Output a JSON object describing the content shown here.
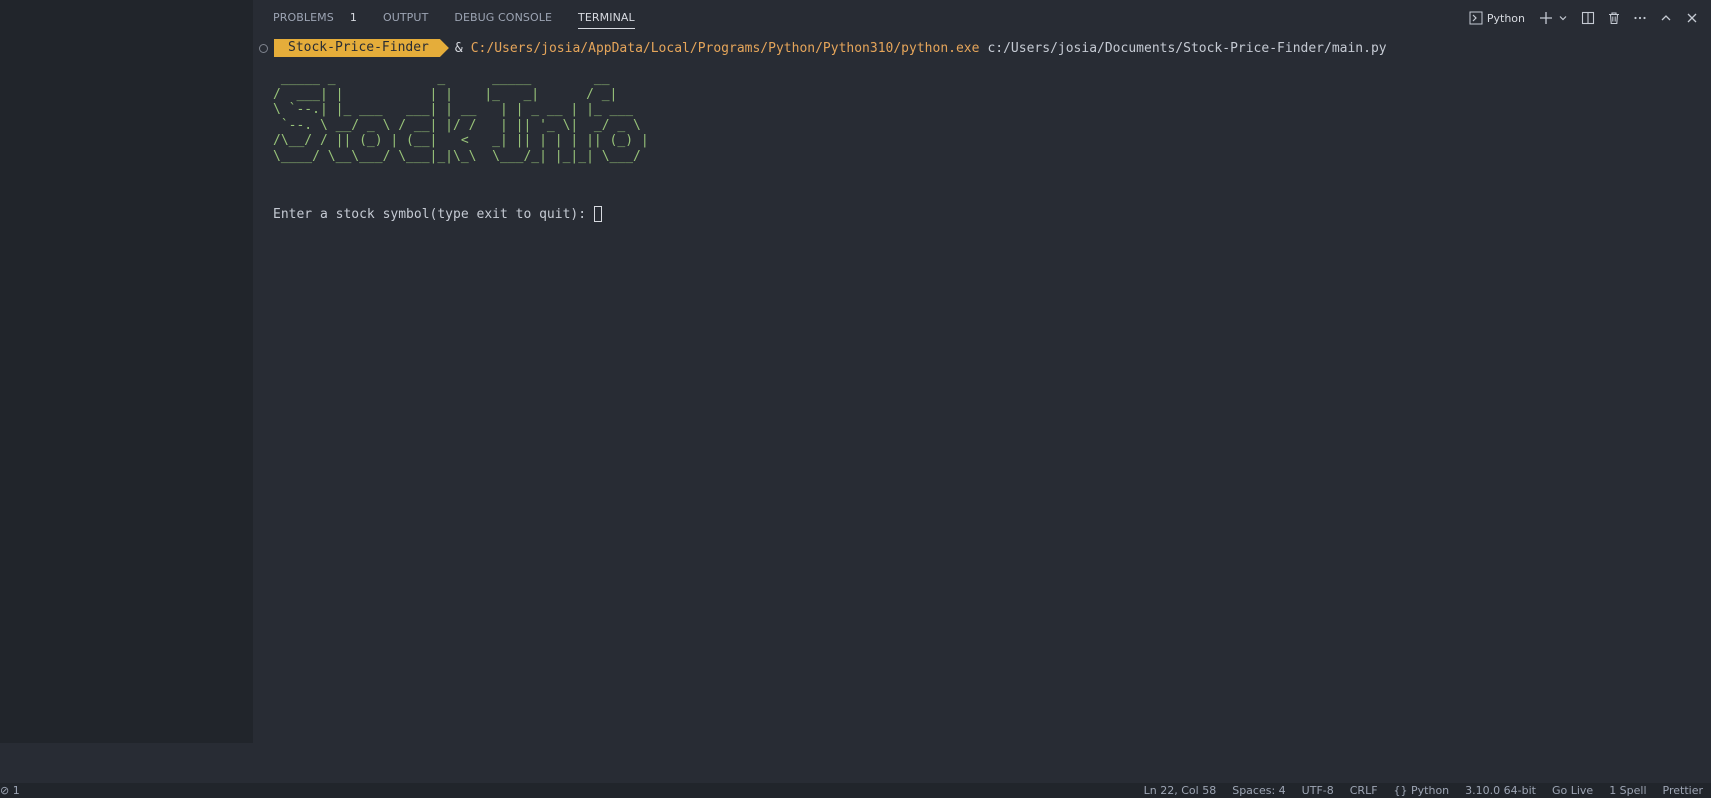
{
  "panel": {
    "tabs": [
      {
        "label": "PROBLEMS",
        "badge": "1"
      },
      {
        "label": "OUTPUT"
      },
      {
        "label": "DEBUG CONSOLE"
      },
      {
        "label": "TERMINAL",
        "active": true
      }
    ],
    "toolbar": {
      "terminal_name": "Python",
      "icons": [
        "terminal-icon",
        "add-icon",
        "chevron-down-icon",
        "split-icon",
        "trash-icon",
        "more-icon",
        "chevron-up-icon",
        "close-icon"
      ]
    }
  },
  "terminal": {
    "prompt_label": "Stock-Price-Finder",
    "amp": "&",
    "command_exe": "C:/Users/josia/AppData/Local/Programs/Python/Python310/python.exe",
    "command_arg": "c:/Users/josia/Documents/Stock-Price-Finder/main.py",
    "ascii_art": " _____ _             _      _____        __      \n/  ___| |           | |    |_   _|      / _|     \n\\ `--.| |_ ___   ___| | __   | | _ __ | |_ ___  \n `--. \\ __/ _ \\ / __| |/ /   | || '_ \\|  _/ _ \\ \n/\\__/ / || (_) | (__|   <   _| || | | | || (_) |\n\\____/ \\__\\___/ \\___|_|\\_\\  \\___/_| |_|_| \\___/ ",
    "input_prompt": "Enter a stock symbol(type exit to quit):"
  },
  "statusbar": {
    "left": "⊘ 1",
    "right": [
      "Ln 22, Col 58",
      "Spaces: 4",
      "UTF-8",
      "CRLF",
      "{} Python",
      "3.10.0 64-bit",
      "Go Live",
      "1 Spell",
      "Prettier"
    ]
  },
  "colors": {
    "background": "#282c34",
    "sidebar": "#21252b",
    "prompt_badge": "#e5ad3a",
    "ascii": "#98c379",
    "exe": "#e5a55a"
  }
}
